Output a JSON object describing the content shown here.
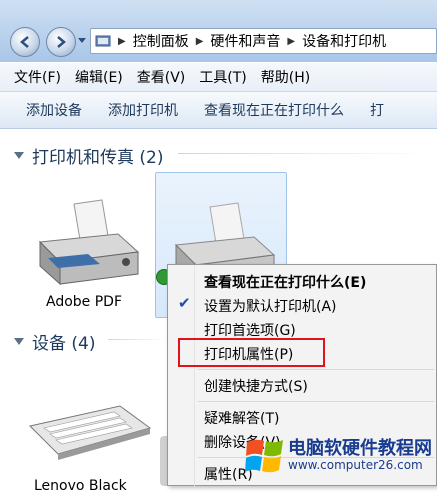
{
  "address": {
    "crumbs": [
      "控制面板",
      "硬件和声音",
      "设备和打印机"
    ]
  },
  "menubar": {
    "items": [
      "文件(F)",
      "编辑(E)",
      "查看(V)",
      "工具(T)",
      "帮助(H)"
    ]
  },
  "commandbar": {
    "items": [
      "添加设备",
      "添加打印机",
      "查看现在正在打印什么",
      "打"
    ]
  },
  "groups": {
    "printers": {
      "title": "打印机和传真 (2)"
    },
    "devices": {
      "title": "设备 (4)"
    }
  },
  "devices": {
    "printer1_label": "Adobe PDF",
    "keyboard_label": "Lenovo Black"
  },
  "context_menu": {
    "items": [
      "查看现在正在打印什么(E)",
      "设置为默认打印机(A)",
      "打印首选项(G)",
      "打印机属性(P)",
      "创建快捷方式(S)",
      "疑难解答(T)",
      "删除设备(V)",
      "属性(R)"
    ]
  },
  "watermark": {
    "title": "电脑软硬件教程网",
    "url": "www.computer26.com"
  },
  "colors": {
    "highlight_box": "#e0121a",
    "checkmark": "#1c4fb0"
  }
}
